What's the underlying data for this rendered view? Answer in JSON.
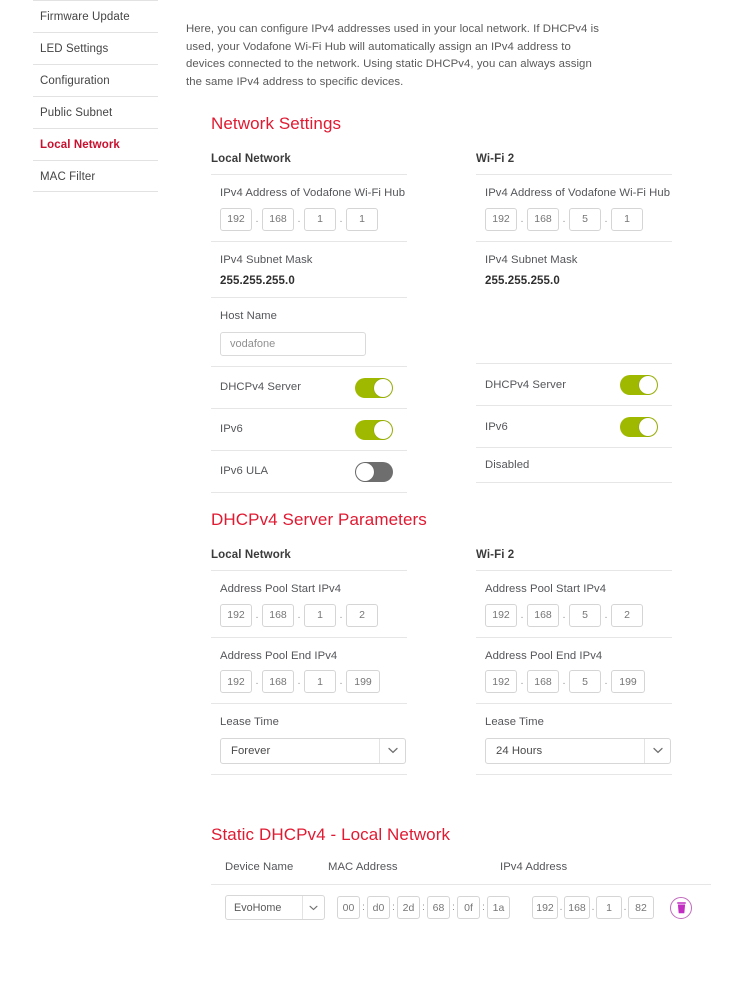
{
  "sidebar": {
    "items": [
      {
        "label": "Firmware Update",
        "active": false
      },
      {
        "label": "LED Settings",
        "active": false
      },
      {
        "label": "Configuration",
        "active": false
      },
      {
        "label": "Public Subnet",
        "active": false
      },
      {
        "label": "Local Network",
        "active": true
      },
      {
        "label": "MAC Filter",
        "active": false
      }
    ]
  },
  "intro": {
    "text": "Here, you can configure IPv4 addresses used in your local network. If DHCPv4 is used, your Vodafone Wi-Fi Hub will automatically assign an IPv4 address to devices connected to the network. Using static DHCPv4, you can always assign the same IPv4 address to specific devices."
  },
  "network_settings": {
    "title": "Network Settings",
    "local": {
      "col_head": "Local Network",
      "ipv4_address_label": "IPv4 Address of Vodafone Wi-Fi Hub",
      "ipv4_address": [
        "192",
        "168",
        "1",
        "1"
      ],
      "subnet_mask_label": "IPv4 Subnet Mask",
      "subnet_mask_value": "255.255.255.0",
      "host_name_label": "Host Name",
      "host_name_value": "vodafone",
      "dhcpv4_label": "DHCPv4 Server",
      "dhcpv4_state": "on",
      "ipv6_label": "IPv6",
      "ipv6_state": "on",
      "ipv6_ula_label": "IPv6 ULA",
      "ipv6_ula_state": "off"
    },
    "wifi2": {
      "col_head": "Wi-Fi 2",
      "ipv4_address_label": "IPv4 Address of Vodafone Wi-Fi Hub",
      "ipv4_address": [
        "192",
        "168",
        "5",
        "1"
      ],
      "subnet_mask_label": "IPv4 Subnet Mask",
      "subnet_mask_value": "255.255.255.0",
      "dhcpv4_label": "DHCPv4 Server",
      "dhcpv4_state": "on",
      "ipv6_label": "IPv6",
      "ipv6_state": "on",
      "ula_status": "Disabled"
    }
  },
  "dhcp_params": {
    "title": "DHCPv4 Server Parameters",
    "local": {
      "col_head": "Local Network",
      "pool_start_label": "Address Pool Start IPv4",
      "pool_start": [
        "192",
        "168",
        "1",
        "2"
      ],
      "pool_end_label": "Address Pool End IPv4",
      "pool_end": [
        "192",
        "168",
        "1",
        "199"
      ],
      "lease_time_label": "Lease Time",
      "lease_time_value": "Forever"
    },
    "wifi2": {
      "col_head": "Wi-Fi 2",
      "pool_start_label": "Address Pool Start IPv4",
      "pool_start": [
        "192",
        "168",
        "5",
        "2"
      ],
      "pool_end_label": "Address Pool End IPv4",
      "pool_end": [
        "192",
        "168",
        "5",
        "199"
      ],
      "lease_time_label": "Lease Time",
      "lease_time_value": "24 Hours"
    }
  },
  "static_dhcp": {
    "title": "Static DHCPv4 - Local Network",
    "headers": {
      "device_name": "Device Name",
      "mac_address": "MAC Address",
      "ipv4_address": "IPv4 Address"
    },
    "rows": [
      {
        "device_name": "EvoHome",
        "mac": [
          "00",
          "d0",
          "2d",
          "68",
          "0f",
          "1a"
        ],
        "ip": [
          "192",
          "168",
          "1",
          "82"
        ]
      }
    ]
  },
  "colors": {
    "accent_red": "#e11931",
    "toggle_on": "#9fb800",
    "toggle_off": "#6e6e6e",
    "delete_magenta": "#c22ec2"
  }
}
